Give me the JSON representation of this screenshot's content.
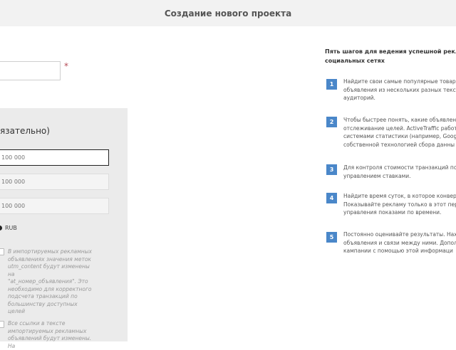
{
  "header": {
    "title": "Создание нового проекта"
  },
  "form": {
    "name_required_mark": "*",
    "panel_heading": "язательно)",
    "budget_inputs": [
      {
        "placeholder": "100 000"
      },
      {
        "placeholder": "100 000"
      },
      {
        "placeholder": "100 000"
      }
    ],
    "currency_label": "RUB",
    "notes": [
      {
        "lines": [
          "В импортируемых рекламных",
          "объявлениях значения меток",
          "utm_content будут изменены на",
          "\"at_номер_объявления\". Это",
          "необходимо для корректного",
          "подсчета транзакций по",
          "большинству доступных целей"
        ]
      },
      {
        "lines": [
          "Все ссылки в тексте",
          "импортируемых рекламных",
          "объявлений будут изменены. На"
        ]
      }
    ]
  },
  "sidebar": {
    "heading_lines": [
      "Пять шагов для ведения успешной рекла",
      "социальных сетях"
    ],
    "steps": [
      {
        "number": "1",
        "lines": [
          "Найдите свои самые популярные товар",
          "объявления из нескольких разных текст",
          "аудиторий."
        ]
      },
      {
        "number": "2",
        "lines": [
          "Чтобы быстрее понять, какие объявлени",
          "отслеживание целей. ActiveTraffic работ",
          "системами статистики (например, Googl",
          "собственной технологией сбора данны"
        ]
      },
      {
        "number": "3",
        "lines": [
          "Для контроля стоимости транзакций по",
          "управлением ставками."
        ]
      },
      {
        "number": "4",
        "lines": [
          "Найдите время суток, в которое конвер",
          "Показывайте рекламу только в этот пер",
          "управления показами по времени."
        ]
      },
      {
        "number": "5",
        "lines": [
          "Постоянно оценивайте результаты. Нах",
          "объявления и связи между ними. Допол",
          "кампании с помощью этой информаци"
        ]
      }
    ]
  }
}
